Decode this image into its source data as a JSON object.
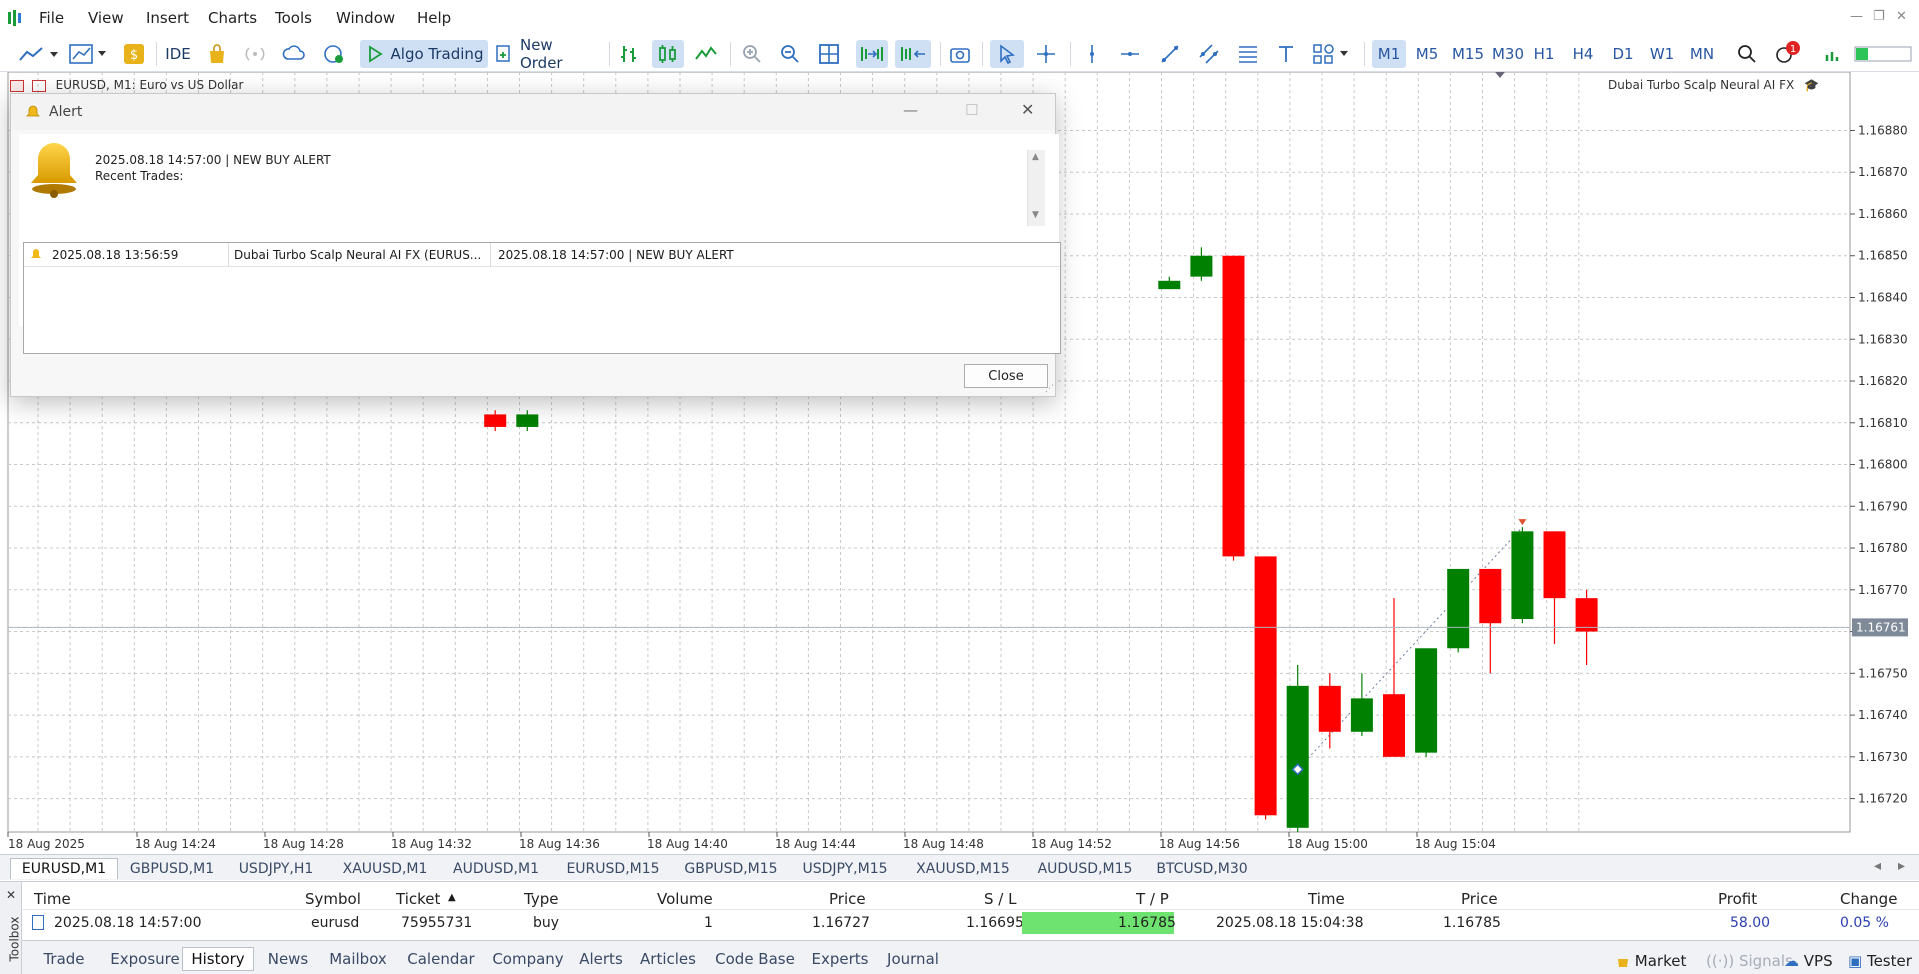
{
  "menu": [
    "File",
    "View",
    "Insert",
    "Charts",
    "Tools",
    "Window",
    "Help"
  ],
  "toolbar": {
    "ide_label": "IDE",
    "algo_trading_label": "Algo Trading",
    "new_order_label": "New Order",
    "timeframes": [
      "M1",
      "M5",
      "M15",
      "M30",
      "H1",
      "H4",
      "D1",
      "W1",
      "MN"
    ],
    "active_timeframe": "M1",
    "notification_count": "1",
    "icons": [
      "line-tool-icon",
      "chart-type-icon",
      "dollar-icon",
      "market-bag-icon",
      "signal-icon",
      "cloud-icon",
      "globe-icon",
      "play-icon",
      "new-order-icon",
      "bar-chart-icon",
      "candles-icon",
      "line-chart-icon",
      "zoom-in-icon",
      "zoom-out-icon",
      "grid-icon",
      "autoscroll-icon",
      "chart-shift-icon",
      "screenshot-icon",
      "cursor-icon",
      "crosshair-icon",
      "vertical-line-icon",
      "horizontal-line-icon",
      "trendline-icon",
      "channel-icon",
      "fibonacci-icon",
      "text-icon",
      "shapes-icon",
      "search-icon",
      "notifications-icon",
      "level-icon"
    ]
  },
  "chart": {
    "title": "EURUSD, M1:  Euro vs US Dollar",
    "ea_name": "Dubai Turbo Scalp Neural AI FX",
    "current_price": "1.16761",
    "colors": {
      "bull": "#008000",
      "bear": "#ff0000",
      "grid": "#c8c8c8",
      "price_tag": "#7f8a99"
    }
  },
  "chart_data": {
    "type": "candlestick",
    "title": "EURUSD, M1:  Euro vs US Dollar",
    "price_ticks": [
      "1.16880",
      "1.16870",
      "1.16860",
      "1.16850",
      "1.16840",
      "1.16830",
      "1.16820",
      "1.16810",
      "1.16800",
      "1.16790",
      "1.16780",
      "1.16770",
      "1.16760",
      "1.16750",
      "1.16740",
      "1.16730",
      "1.16720"
    ],
    "time_ticks": [
      "18 Aug 2025",
      "18 Aug 14:24",
      "18 Aug 14:28",
      "18 Aug 14:32",
      "18 Aug 14:36",
      "18 Aug 14:40",
      "18 Aug 14:44",
      "18 Aug 14:48",
      "18 Aug 14:52",
      "18 Aug 14:56",
      "18 Aug 15:00",
      "18 Aug 15:04"
    ],
    "ylim": [
      1.16712,
      1.16894
    ],
    "candles": [
      {
        "time": "14:32",
        "open": 1.16812,
        "high": 1.16813,
        "low": 1.16808,
        "close": 1.16809
      },
      {
        "time": "14:33",
        "open": 1.16809,
        "high": 1.16813,
        "low": 1.16808,
        "close": 1.16812
      },
      {
        "time": "14:53",
        "open": 1.16842,
        "high": 1.16845,
        "low": 1.16842,
        "close": 1.16844
      },
      {
        "time": "14:54",
        "open": 1.16845,
        "high": 1.16852,
        "low": 1.16844,
        "close": 1.1685
      },
      {
        "time": "14:55",
        "open": 1.1685,
        "high": 1.1685,
        "low": 1.16777,
        "close": 1.16778
      },
      {
        "time": "14:56",
        "open": 1.16778,
        "high": 1.16778,
        "low": 1.16715,
        "close": 1.16716
      },
      {
        "time": "14:57",
        "open": 1.16713,
        "high": 1.16752,
        "low": 1.16712,
        "close": 1.16747
      },
      {
        "time": "14:58",
        "open": 1.16747,
        "high": 1.1675,
        "low": 1.16732,
        "close": 1.16736
      },
      {
        "time": "14:59",
        "open": 1.16736,
        "high": 1.1675,
        "low": 1.16735,
        "close": 1.16744
      },
      {
        "time": "15:00",
        "open": 1.16745,
        "high": 1.16768,
        "low": 1.16732,
        "close": 1.1673
      },
      {
        "time": "15:01",
        "open": 1.16731,
        "high": 1.16755,
        "low": 1.1673,
        "close": 1.16756
      },
      {
        "time": "15:02",
        "open": 1.16756,
        "high": 1.16775,
        "low": 1.16755,
        "close": 1.16775
      },
      {
        "time": "15:03",
        "open": 1.16775,
        "high": 1.16775,
        "low": 1.1675,
        "close": 1.16762
      },
      {
        "time": "15:04",
        "open": 1.16763,
        "high": 1.16785,
        "low": 1.16762,
        "close": 1.16784
      },
      {
        "time": "15:05",
        "open": 1.16784,
        "high": 1.16784,
        "low": 1.16757,
        "close": 1.16768
      },
      {
        "time": "15:06",
        "open": 1.16768,
        "high": 1.1677,
        "low": 1.16752,
        "close": 1.1676
      }
    ],
    "trade": {
      "entry_time": "14:57",
      "entry_price": 1.16727,
      "exit_time": "15:04",
      "exit_price": 1.16785
    },
    "current_price": 1.16761,
    "grid": true
  },
  "alert": {
    "title": "Alert",
    "message": "2025.08.18 14:57:00 |  NEW BUY ALERT",
    "sub": "Recent Trades:",
    "list": [
      {
        "time": "2025.08.18 13:56:59",
        "source": "Dubai Turbo Scalp Neural AI FX (EURUS...",
        "message": "2025.08.18 14:57:00 |  NEW BUY ALERT"
      }
    ],
    "close_label": "Close"
  },
  "symbol_tabs": [
    "EURUSD,M1",
    "GBPUSD,M1",
    "USDJPY,H1",
    "XAUUSD,M1",
    "AUDUSD,M1",
    "EURUSD,M15",
    "GBPUSD,M15",
    "USDJPY,M15",
    "XAUUSD,M15",
    "AUDUSD,M15",
    "BTCUSD,M30"
  ],
  "toolbox": {
    "label": "Toolbox",
    "columns": [
      "Time",
      "Symbol",
      "Ticket",
      "Type",
      "Volume",
      "Price",
      "S / L",
      "T / P",
      "Time",
      "Price",
      "Profit",
      "Change"
    ],
    "rows": [
      [
        "2025.08.18 14:57:00",
        "eurusd",
        "75955731",
        "buy",
        "1",
        "1.16727",
        "1.16695",
        "1.16785",
        "2025.08.18 15:04:38",
        "1.16785",
        "58.00",
        "0.05 %"
      ]
    ],
    "tabs": [
      "Trade",
      "Exposure",
      "History",
      "News",
      "Mailbox",
      "Calendar",
      "Company",
      "Alerts",
      "Articles",
      "Code Base",
      "Experts",
      "Journal"
    ],
    "active_tab": "History",
    "status": {
      "market": "Market",
      "signals": "Signals",
      "vps": "VPS",
      "tester": "Tester"
    }
  }
}
